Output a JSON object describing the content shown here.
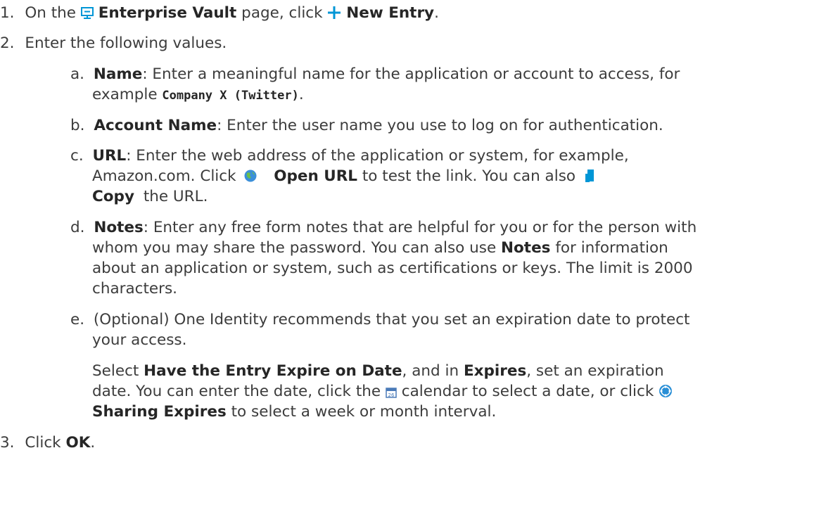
{
  "steps": {
    "s1": {
      "num": "1.",
      "t1": "On the",
      "vault": "Enterprise Vault",
      "t2": "page, click",
      "new_entry": "New Entry",
      "t3": "."
    },
    "s2": {
      "num": "2.",
      "text": "Enter the following values."
    },
    "s3": {
      "num": "3.",
      "t1": "Click",
      "ok": "OK",
      "t2": "."
    }
  },
  "items": {
    "a": {
      "letter": "a.",
      "term": "Name",
      "t1": ": Enter a meaningful name for the application or account to access, for",
      "t2": "example",
      "code": "Company X (Twitter)",
      "t3": "."
    },
    "b": {
      "letter": "b.",
      "term": "Account Name",
      "t1": ": Enter the user name you use to log on for authentication."
    },
    "c": {
      "letter": "c.",
      "term": "URL",
      "t1": ": Enter the web address of the application or system, for example,",
      "t2": "Amazon.com. Click",
      "open_url": "Open URL",
      "t3": "to test the link. You can also",
      "copy": "Copy",
      "t4": "the URL."
    },
    "d": {
      "letter": "d.",
      "term": "Notes",
      "t1": ": Enter any free form notes that are helpful for you or for the person with",
      "t2": "whom you may share the password. You can also use",
      "notes2": "Notes",
      "t3": "for information",
      "t4": "about an application or system, such as certifications or keys. The limit is 2000",
      "t5": "characters."
    },
    "e": {
      "letter": "e.",
      "t1": "(Optional) One Identity recommends that you set an expiration date to protect",
      "t2": "your access.",
      "p2a": "Select",
      "expire_opt": "Have the Entry Expire on Date",
      "p2b": ", and in",
      "expires": "Expires",
      "p2c": ", set an expiration",
      "p3a": "date. You can enter the date, click the",
      "p3b": "calendar to select a date, or click",
      "sharing": "Sharing Expires",
      "p4": "to select a week or month interval."
    }
  },
  "icons": {
    "vault": "monitor-vault-icon",
    "plus": "plus-icon",
    "globe": "globe-icon",
    "copy": "copy-icon",
    "calendar": "calendar-icon",
    "sharing": "sharing-expires-icon",
    "accent": "#0096d6"
  }
}
